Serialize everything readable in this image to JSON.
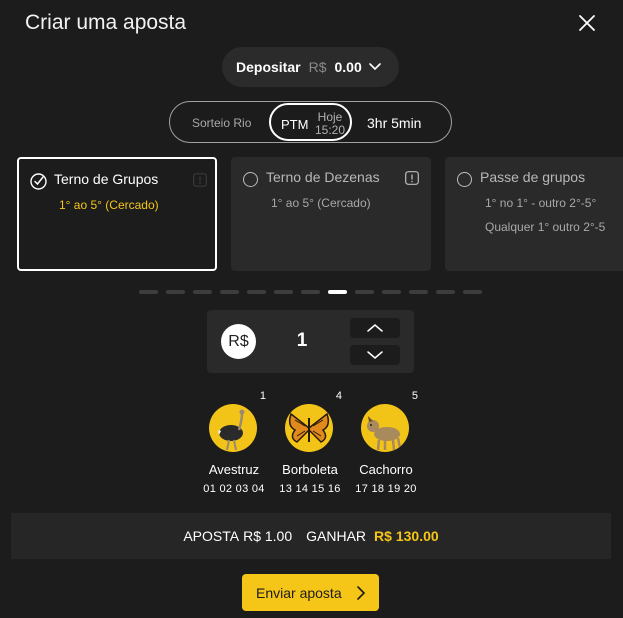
{
  "header": {
    "title": "Criar uma aposta"
  },
  "deposit": {
    "label": "Depositar",
    "currency": "R$",
    "balance": "0.00"
  },
  "lottery": {
    "name": "Sorteio Rio",
    "draw": "PTM",
    "day": "Hoje",
    "time": "15:20",
    "remaining": "3hr 5min"
  },
  "bet_types": [
    {
      "name": "Terno de Grupos",
      "line1": "1° ao 5° (Cercado)",
      "line2": "",
      "selected": true
    },
    {
      "name": "Terno de Dezenas",
      "line1": "1° ao 5° (Cercado)",
      "line2": "",
      "selected": false
    },
    {
      "name": "Passe de grupos",
      "line1": "1° no 1° - outro 2°-5°",
      "line2": "Qualquer 1° outro 2°-5",
      "selected": false
    }
  ],
  "pagination": {
    "total": 13,
    "active_index": 7
  },
  "stake": {
    "currency": "R$",
    "amount": "1"
  },
  "animals": [
    {
      "group": "1",
      "name": "Avestruz",
      "numbers": "01 02 03 04",
      "icon": "ostrich-icon"
    },
    {
      "group": "4",
      "name": "Borboleta",
      "numbers": "13 14 15 16",
      "icon": "butterfly-icon"
    },
    {
      "group": "5",
      "name": "Cachorro",
      "numbers": "17 18 19 20",
      "icon": "dog-icon"
    }
  ],
  "summary": {
    "bet_label": "APOSTA",
    "bet_value": "R$ 1.00",
    "win_label": "GANHAR",
    "win_value": "R$ 130.00"
  },
  "submit": {
    "label": "Enviar aposta"
  },
  "colors": {
    "accent": "#f5c518",
    "background": "#1c1c1c",
    "card": "#2a2a2a"
  }
}
